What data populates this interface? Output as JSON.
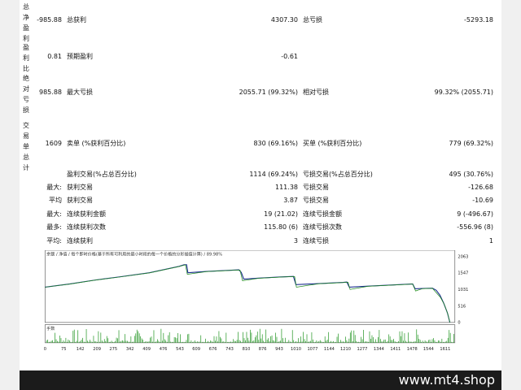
{
  "sections": [
    {
      "label": "总净盈利"
    },
    {
      "label": "盈利比"
    },
    {
      "label": "绝对亏损"
    },
    {
      "label": "交易单总计"
    }
  ],
  "stats": {
    "net": {
      "value": "-985.88",
      "gross_profit_label": "总获利",
      "gross_profit": "4307.30",
      "gross_loss_label": "总亏损",
      "gross_loss": "-5293.18"
    },
    "ratio": {
      "value": "0.81",
      "expected_label": "预期盈利",
      "expected": "-0.61"
    },
    "drawdown": {
      "value": "985.88",
      "max_label": "最大亏损",
      "max": "2055.71 (99.32%)",
      "rel_label": "相对亏损",
      "rel": "99.32% (2055.71)"
    },
    "trades": {
      "value": "1609",
      "short_label": "卖单 (%获利百分比)",
      "short": "830 (69.16%)",
      "long_label": "买单 (%获利百分比)",
      "long": "779 (69.32%)"
    }
  },
  "detail_rows": [
    {
      "prefix": "",
      "l_label": "盈利交易(%占总百分比)",
      "l_val": "1114 (69.24%)",
      "r_label": "亏损交易(%占总百分比)",
      "r_val": "495 (30.76%)"
    },
    {
      "prefix": "最大:",
      "l_label": "获利交易",
      "l_val": "111.38",
      "r_label": "亏损交易",
      "r_val": "-126.68"
    },
    {
      "prefix": "平均",
      "l_label": "获利交易",
      "l_val": "3.87",
      "r_label": "亏损交易",
      "r_val": "-10.69"
    },
    {
      "prefix": "最大:",
      "l_label": "连续获利金额",
      "l_val": "19 (21.02)",
      "r_label": "连续亏损金额",
      "r_val": "9 (-496.67)"
    },
    {
      "prefix": "最多:",
      "l_label": "连续获利次数",
      "l_val": "115.80 (6)",
      "r_label": "连续亏损次数",
      "r_val": "-556.96 (8)"
    },
    {
      "prefix": "平均:",
      "l_label": "连续获利",
      "l_val": "3",
      "r_label": "连续亏损",
      "r_val": "1"
    }
  ],
  "chart_data": {
    "type": "line",
    "title": "余额 / 净值 / 每个即时价格(基于所有可利用的最小时段的每一个价格的分形插值计算) / 89.98%",
    "y_ticks": [
      "2063",
      "1547",
      "1031",
      "516",
      "0"
    ],
    "x_ticks": [
      "0",
      "75",
      "142",
      "209",
      "275",
      "342",
      "409",
      "476",
      "543",
      "609",
      "676",
      "743",
      "810",
      "876",
      "943",
      "1010",
      "1077",
      "1144",
      "1210",
      "1277",
      "1344",
      "1411",
      "1478",
      "1544",
      "1611"
    ],
    "ylim": [
      0,
      2063
    ],
    "xlim": [
      0,
      1650
    ],
    "series": [
      {
        "name": "余额",
        "points": [
          [
            0,
            1100
          ],
          [
            100,
            1200
          ],
          [
            200,
            1320
          ],
          [
            300,
            1420
          ],
          [
            420,
            1550
          ],
          [
            540,
            1750
          ],
          [
            560,
            1800
          ],
          [
            570,
            1800
          ],
          [
            575,
            1550
          ],
          [
            650,
            1590
          ],
          [
            750,
            1630
          ],
          [
            780,
            1640
          ],
          [
            790,
            1560
          ],
          [
            800,
            1350
          ],
          [
            860,
            1380
          ],
          [
            950,
            1420
          ],
          [
            1000,
            1435
          ],
          [
            1010,
            1180
          ],
          [
            1100,
            1210
          ],
          [
            1200,
            1250
          ],
          [
            1215,
            1260
          ],
          [
            1225,
            1100
          ],
          [
            1300,
            1130
          ],
          [
            1400,
            1170
          ],
          [
            1480,
            1200
          ],
          [
            1490,
            1050
          ],
          [
            1520,
            1060
          ],
          [
            1560,
            1070
          ],
          [
            1575,
            1000
          ],
          [
            1590,
            850
          ],
          [
            1605,
            600
          ],
          [
            1620,
            300
          ],
          [
            1630,
            0
          ]
        ]
      },
      {
        "name": "净值",
        "points": [
          [
            0,
            1100
          ],
          [
            100,
            1195
          ],
          [
            200,
            1315
          ],
          [
            300,
            1415
          ],
          [
            420,
            1545
          ],
          [
            540,
            1745
          ],
          [
            565,
            1795
          ],
          [
            573,
            1500
          ],
          [
            650,
            1585
          ],
          [
            750,
            1625
          ],
          [
            785,
            1635
          ],
          [
            795,
            1300
          ],
          [
            860,
            1375
          ],
          [
            950,
            1415
          ],
          [
            1005,
            1430
          ],
          [
            1012,
            1100
          ],
          [
            1100,
            1205
          ],
          [
            1200,
            1245
          ],
          [
            1220,
            1255
          ],
          [
            1228,
            1030
          ],
          [
            1300,
            1125
          ],
          [
            1400,
            1165
          ],
          [
            1480,
            1195
          ],
          [
            1492,
            980
          ],
          [
            1520,
            1055
          ],
          [
            1560,
            1065
          ],
          [
            1578,
            900
          ],
          [
            1592,
            780
          ],
          [
            1608,
            550
          ],
          [
            1622,
            250
          ],
          [
            1630,
            0
          ]
        ]
      }
    ],
    "volume_label": "手数",
    "colors": {
      "balance": "#1c2d8f",
      "equity": "#1f8a1f",
      "volume": "#2e9b2e"
    }
  },
  "brand": "www.mt4.shop"
}
